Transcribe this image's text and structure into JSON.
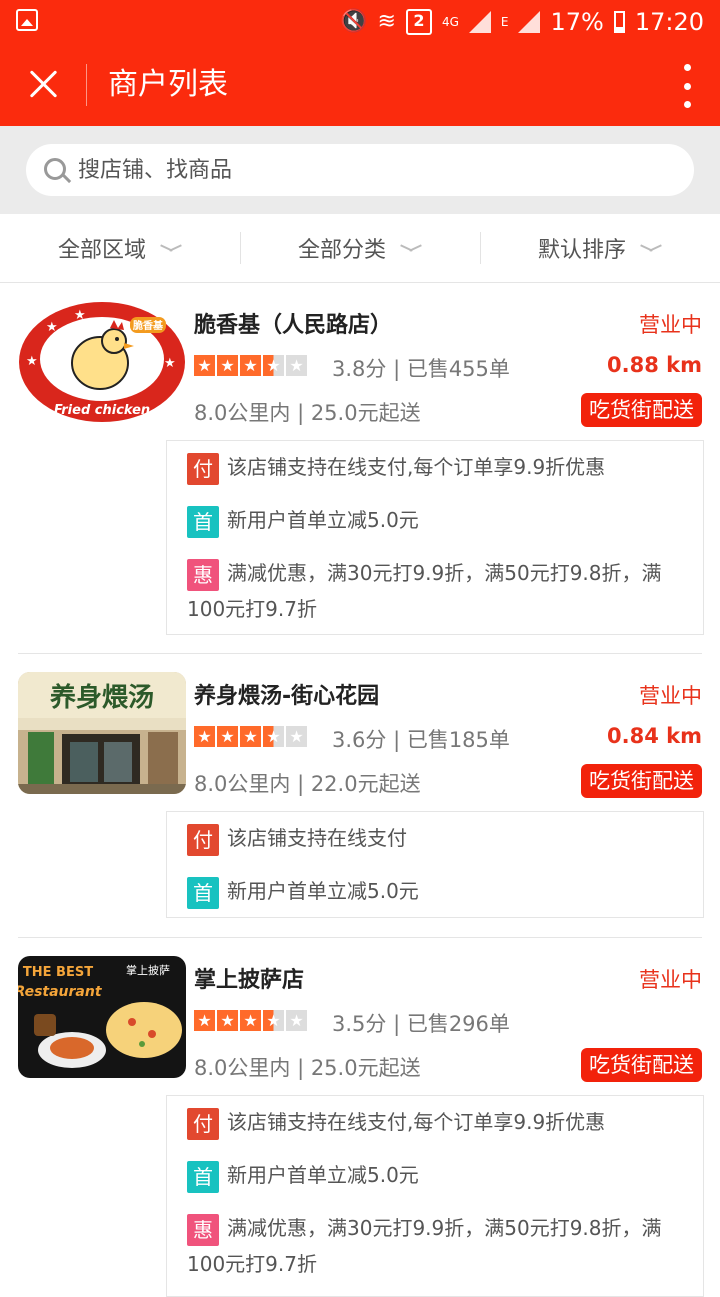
{
  "status_bar": {
    "battery": "17%",
    "time": "17:20",
    "sim": "2",
    "network_4g": "4G",
    "network_e": "E",
    "icons": [
      "image-icon",
      "mute-icon",
      "wifi-icon",
      "signal-icon",
      "battery-icon"
    ]
  },
  "header": {
    "title": "商户列表"
  },
  "search": {
    "placeholder": "搜店铺、找商品"
  },
  "filters": [
    "全部区域",
    "全部分类",
    "默认排序"
  ],
  "colors": {
    "brand": "#fb2b0d",
    "accent": "#e8321b",
    "star": "#ff6a2a"
  },
  "stores": [
    {
      "name": "脆香基（人民路店）",
      "status": "营业中",
      "distance": "0.88 km",
      "rating_stars": 3.5,
      "rating_text": "3.8分 | 已售455单",
      "range": "8.0公里内 | 25.0元起送",
      "delivery": "吃货街配送",
      "promos": [
        {
          "tag": "付",
          "text": "该店铺支持在线支付,每个订单享9.9折优惠"
        },
        {
          "tag": "首",
          "text": "新用户首单立减5.0元"
        },
        {
          "tag": "惠",
          "text": "满减优惠，满30元打9.9折，满50元打9.8折，满100元打9.7折"
        }
      ]
    },
    {
      "name": "养身煨汤-街心花园",
      "status": "营业中",
      "distance": "0.84 km",
      "rating_stars": 3.5,
      "rating_text": "3.6分 | 已售185单",
      "range": "8.0公里内 | 22.0元起送",
      "delivery": "吃货街配送",
      "promos": [
        {
          "tag": "付",
          "text": "该店铺支持在线支付"
        },
        {
          "tag": "首",
          "text": "新用户首单立减5.0元"
        }
      ]
    },
    {
      "name": "掌上披萨店",
      "status": "营业中",
      "distance": "",
      "rating_stars": 3.5,
      "rating_text": "3.5分 | 已售296单",
      "range": "8.0公里内 | 25.0元起送",
      "delivery": "吃货街配送",
      "promos": [
        {
          "tag": "付",
          "text": "该店铺支持在线支付,每个订单享9.9折优惠"
        },
        {
          "tag": "首",
          "text": "新用户首单立减5.0元"
        },
        {
          "tag": "惠",
          "text": "满减优惠，满30元打9.9折，满50元打9.8折，满100元打9.7折"
        }
      ]
    }
  ],
  "thumb_text": {
    "s1_logo": "脆香基",
    "s1_sub": "Fried chicken",
    "s2_sign": "养身煨汤",
    "s3_line1": "THE BEST",
    "s3_line2": "Restaurant",
    "s3_line3": "掌上披萨"
  }
}
